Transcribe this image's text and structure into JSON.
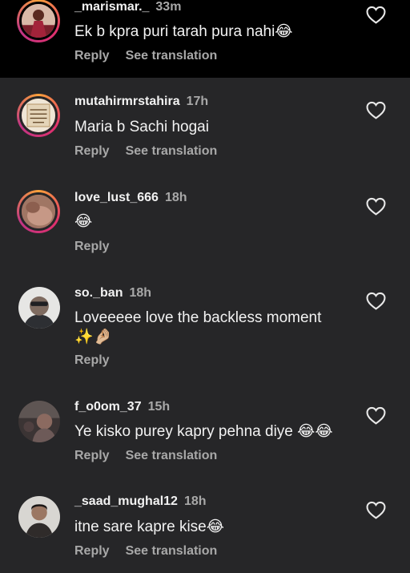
{
  "comments": [
    {
      "username": "_marismar._",
      "time": "33m",
      "text": "Ek b kpra puri tarah pura nahi😂",
      "reply": "Reply",
      "translation": "See translation",
      "avatar": "photo-avatar-with-story-ring"
    },
    {
      "username": "mutahirmrstahira",
      "time": "17h",
      "text": "Maria b Sachi hogai",
      "reply": "Reply",
      "translation": "See translation",
      "avatar": "text-image-avatar-with-story-ring"
    },
    {
      "username": "love_lust_666",
      "time": "18h",
      "text": "😂",
      "reply": "Reply",
      "avatar": "photo-avatar-with-story-ring"
    },
    {
      "username": "so._ban",
      "time": "18h",
      "text": "Loveeeee love the backless moment ✨🤌🏼",
      "reply": "Reply",
      "avatar": "photo-avatar"
    },
    {
      "username": "f_o0om_37",
      "time": "15h",
      "text": "Ye kisko purey kapry pehna diye 😂😂",
      "reply": "Reply",
      "translation": "See translation",
      "avatar": "photo-avatar"
    },
    {
      "username": "_saad_mughal12",
      "time": "18h",
      "text": "itne sare kapre kise😂",
      "reply": "Reply",
      "translation": "See translation",
      "avatar": "photo-avatar"
    }
  ],
  "icons": {
    "like": "heart-outline-icon"
  },
  "colors": {
    "background": "#262628",
    "top_comment_background": "#000000",
    "primary_text": "#f2f2f2",
    "secondary_text": "#a8a8a8",
    "story_ring": "#e1306c"
  }
}
